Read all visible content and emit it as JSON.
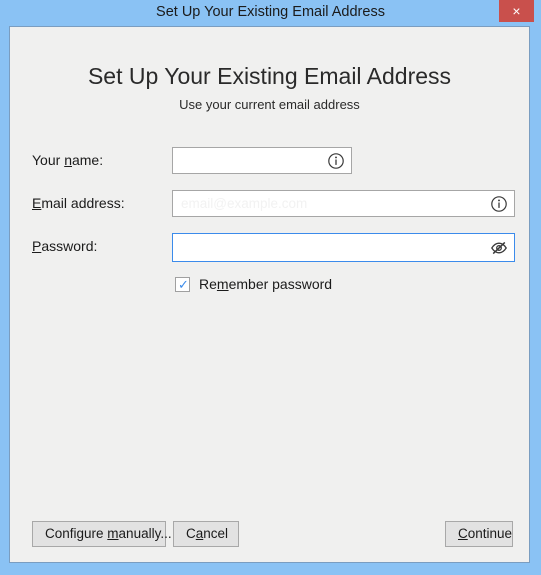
{
  "window": {
    "title": "Set Up Your Existing Email Address",
    "close_label": "×",
    "chrome_color": "#8ac2f4",
    "close_color": "#c9504c",
    "content_color": "#f0f0ef"
  },
  "dialog": {
    "heading": "Set Up Your Existing Email Address",
    "subheading": "Use your current email address"
  },
  "form": {
    "name": {
      "label_pre": "Your ",
      "label_accel": "n",
      "label_post": "ame:",
      "value": "",
      "placeholder": "",
      "icon": "info-icon"
    },
    "email": {
      "label_pre": "",
      "label_accel": "E",
      "label_post": "mail address:",
      "value": "",
      "placeholder": "email@example.com",
      "icon": "info-icon"
    },
    "password": {
      "label_pre": "",
      "label_accel": "P",
      "label_post": "assword:",
      "value": "",
      "placeholder": "",
      "icon": "eye-off-icon",
      "focus_color": "#3b8beb"
    },
    "remember": {
      "label_pre": "Re",
      "label_accel": "m",
      "label_post": "ember password",
      "checked": true,
      "check_glyph": "✓",
      "check_color": "#3b8beb"
    }
  },
  "buttons": {
    "configure": {
      "label_pre": "Configure ",
      "label_accel": "m",
      "label_post": "anually..."
    },
    "cancel": {
      "label_pre": "C",
      "label_accel": "a",
      "label_post": "ncel"
    },
    "continue": {
      "label_pre": "",
      "label_accel": "C",
      "label_post": "ontinue"
    }
  }
}
